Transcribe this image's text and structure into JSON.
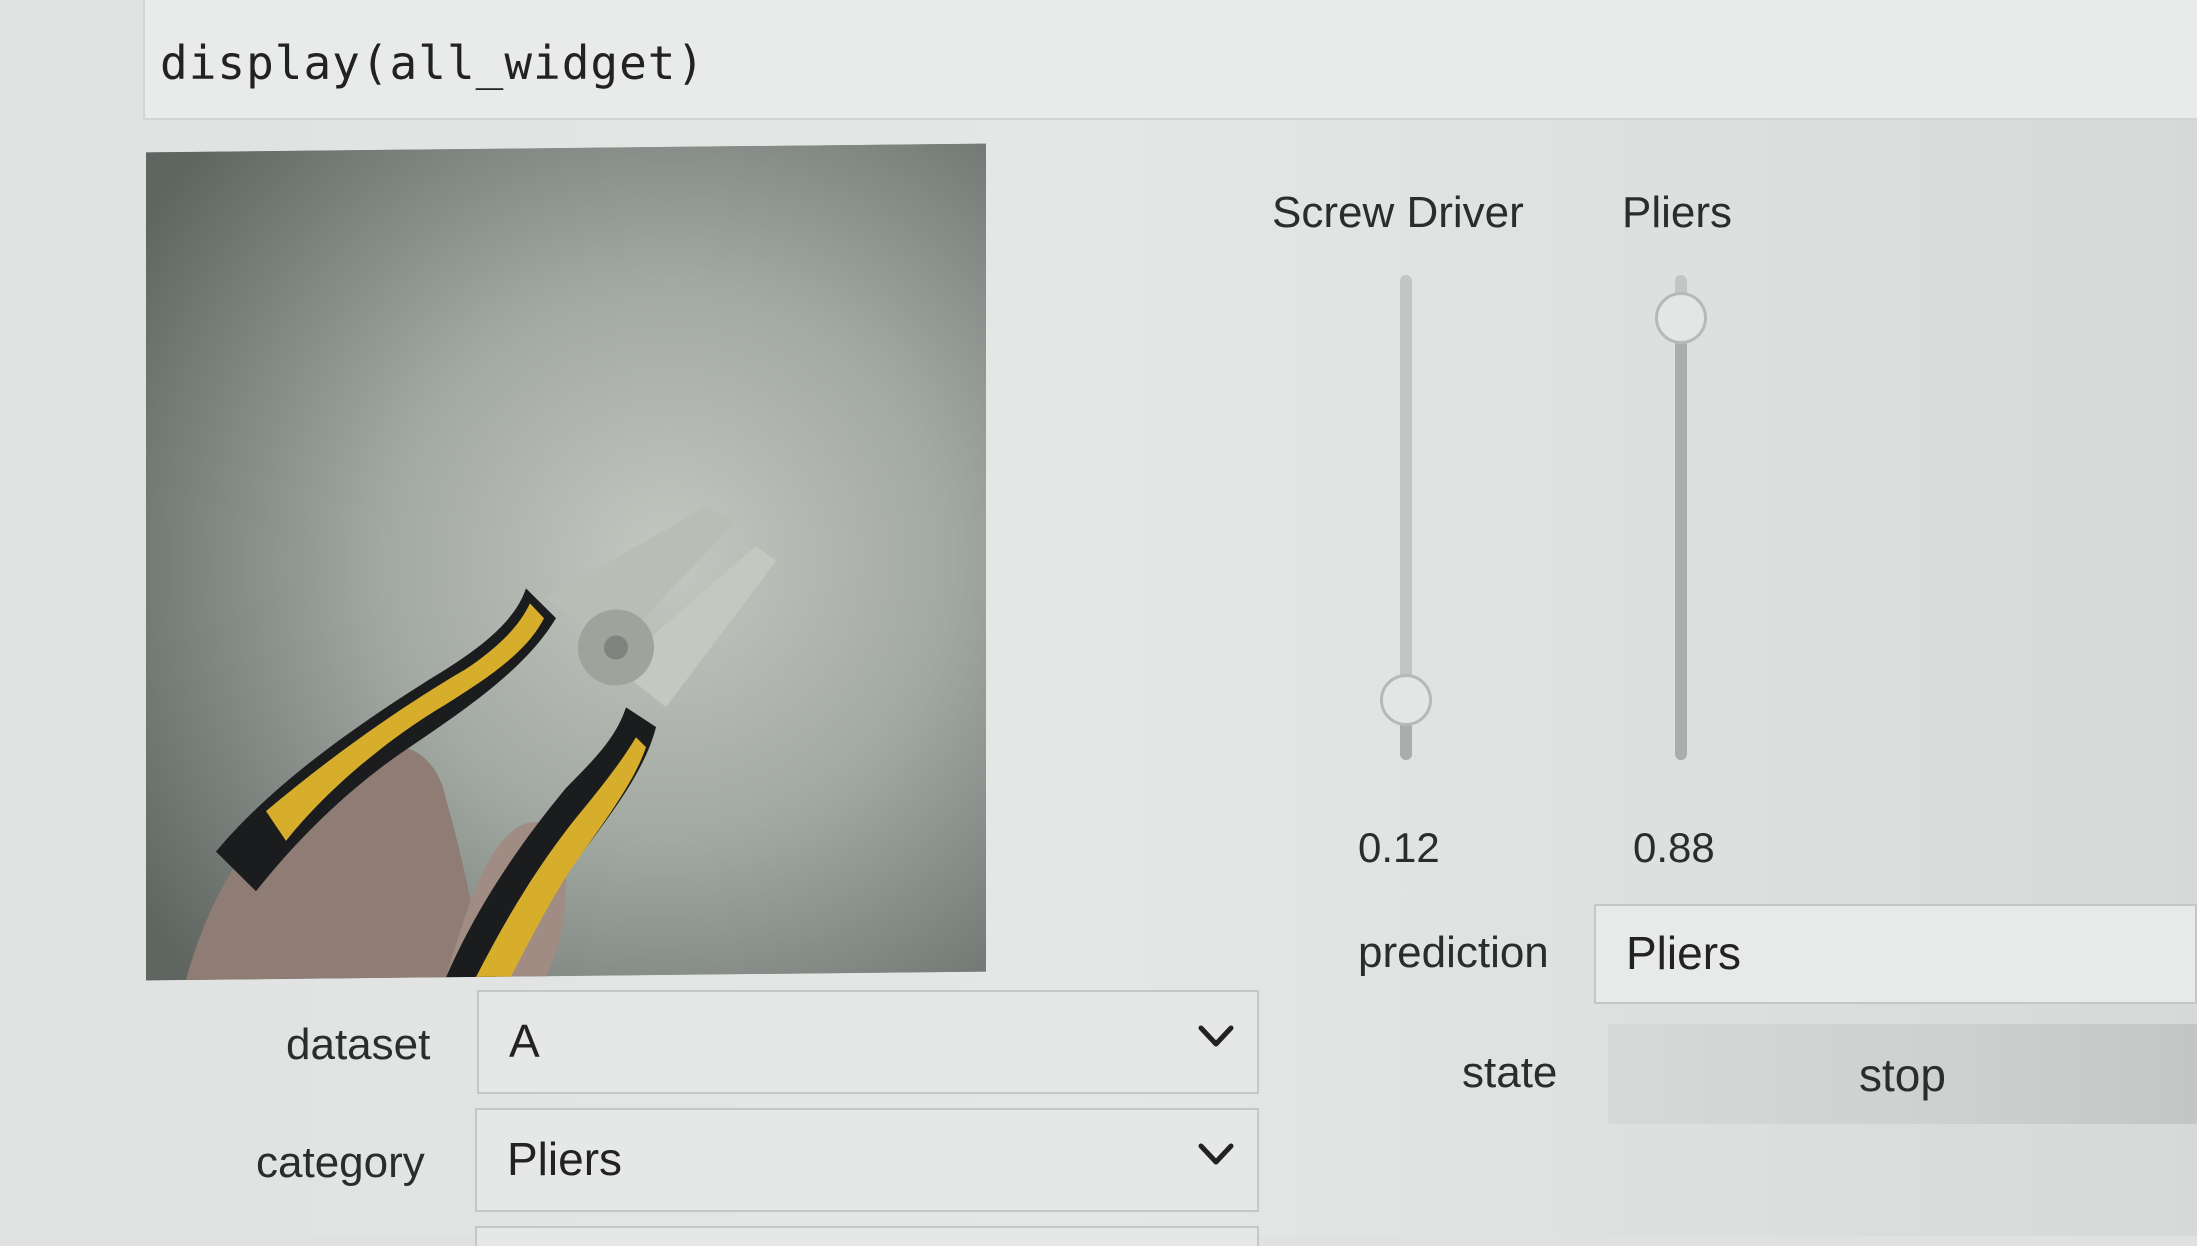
{
  "code_cell": {
    "source": "display(all_widget)"
  },
  "camera": {
    "image_name": "pliers-camera-frame"
  },
  "dataset": {
    "label": "dataset",
    "value": "A"
  },
  "category": {
    "label": "category",
    "value": "Pliers"
  },
  "sliders": [
    {
      "label": "Screw Driver",
      "value": 0.12,
      "value_text": "0.12"
    },
    {
      "label": "Pliers",
      "value": 0.88,
      "value_text": "0.88"
    }
  ],
  "prediction": {
    "label": "prediction",
    "value": "Pliers"
  },
  "state": {
    "label": "state",
    "value": "stop"
  },
  "icons": {
    "dropdown": "chevron-down-icon"
  }
}
